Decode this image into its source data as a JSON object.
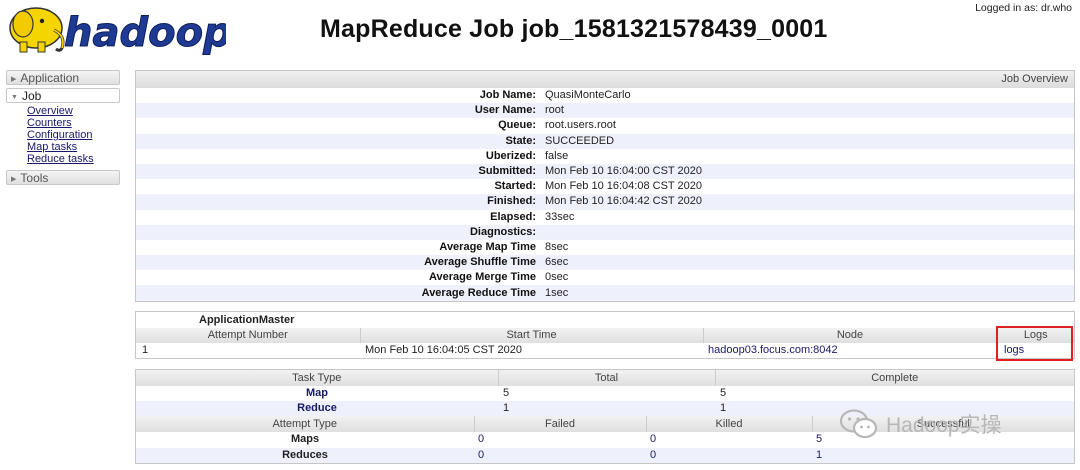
{
  "header": {
    "logo_text": "hadoop",
    "page_title": "MapReduce Job job_1581321578439_0001",
    "login_info": "Logged in as: dr.who"
  },
  "nav": {
    "application": "Application",
    "job": "Job",
    "job_items": [
      "Overview",
      "Counters",
      "Configuration",
      "Map tasks",
      "Reduce tasks"
    ],
    "tools": "Tools"
  },
  "overview": {
    "panel_title": "Job Overview",
    "rows": [
      {
        "label": "Job Name:",
        "value": "QuasiMonteCarlo"
      },
      {
        "label": "User Name:",
        "value": "root"
      },
      {
        "label": "Queue:",
        "value": "root.users.root"
      },
      {
        "label": "State:",
        "value": "SUCCEEDED"
      },
      {
        "label": "Uberized:",
        "value": "false"
      },
      {
        "label": "Submitted:",
        "value": "Mon Feb 10 16:04:00 CST 2020"
      },
      {
        "label": "Started:",
        "value": "Mon Feb 10 16:04:08 CST 2020"
      },
      {
        "label": "Finished:",
        "value": "Mon Feb 10 16:04:42 CST 2020"
      },
      {
        "label": "Elapsed:",
        "value": "33sec"
      },
      {
        "label": "Diagnostics:",
        "value": ""
      },
      {
        "label": "Average Map Time",
        "value": "8sec"
      },
      {
        "label": "Average Shuffle Time",
        "value": "6sec"
      },
      {
        "label": "Average Merge Time",
        "value": "0sec"
      },
      {
        "label": "Average Reduce Time",
        "value": "1sec"
      }
    ]
  },
  "application_master": {
    "title": "ApplicationMaster",
    "columns": [
      "Attempt Number",
      "Start Time",
      "Node",
      "Logs"
    ],
    "row": {
      "attempt": "1",
      "start_time": "Mon Feb 10 16:04:05 CST 2020",
      "node": "hadoop03.focus.com:8042",
      "logs": "logs"
    }
  },
  "tasks": {
    "columns": [
      "Task Type",
      "Total",
      "Complete"
    ],
    "rows": [
      {
        "type": "Map",
        "total": "5",
        "complete": "5"
      },
      {
        "type": "Reduce",
        "total": "1",
        "complete": "1"
      }
    ],
    "attempt_columns": [
      "Attempt Type",
      "Failed",
      "Killed",
      "Successful"
    ],
    "attempt_rows": [
      {
        "type": "Maps",
        "failed": "0",
        "killed": "0",
        "successful": "5"
      },
      {
        "type": "Reduces",
        "failed": "0",
        "killed": "0",
        "successful": "1"
      }
    ]
  },
  "watermark": {
    "text": "Hadoop实操",
    "icon": "wechat-icon"
  },
  "colors": {
    "highlight": "#e02020",
    "row_alt": "#eef1fb",
    "link": "#1a1a6a",
    "logo_yellow": "#f5d500",
    "logo_blue": "#1f3a93"
  }
}
